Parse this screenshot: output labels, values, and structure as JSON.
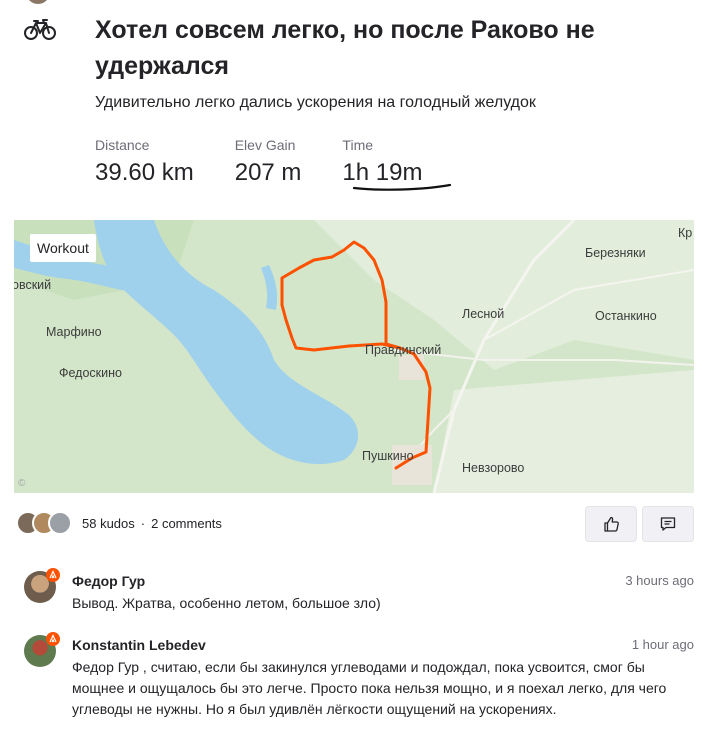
{
  "activity": {
    "icon": "bike-icon",
    "title": "Хотел совсем легко, но после Раково не удержался",
    "description": "Удивительно легко дались ускорения на голодный желудок"
  },
  "stats": [
    {
      "label": "Distance",
      "value": "39.60 km"
    },
    {
      "label": "Elev Gain",
      "value": "207 m"
    },
    {
      "label": "Time",
      "value": "1h 19m"
    }
  ],
  "map": {
    "badge": "Workout",
    "places": [
      {
        "name": "Кр"
      },
      {
        "name": "Березняки"
      },
      {
        "name": "овский"
      },
      {
        "name": "Лесной"
      },
      {
        "name": "Останкино"
      },
      {
        "name": "Марфино"
      },
      {
        "name": "Правдинский"
      },
      {
        "name": "Федоскино"
      },
      {
        "name": "Пушкино"
      },
      {
        "name": "Невзорово"
      }
    ],
    "route_color": "#fc5200"
  },
  "social": {
    "kudos": "58 kudos",
    "separator": "·",
    "comments": "2 comments",
    "kudos_button_icon": "thumbs-up-icon",
    "comment_button_icon": "comment-icon"
  },
  "comments": [
    {
      "author": "Федор Гур",
      "time": "3 hours ago",
      "text": "Вывод. Жратва, особенно летом, большое зло)"
    },
    {
      "author": "Konstantin Lebedev",
      "time": "1 hour ago",
      "text": "Федор Гур , считаю, если бы закинулся углеводами и подождал, пока усвоится, смог бы мощнее и ощущалось бы это легче. Просто пока нельзя мощно, и я поехал легко, для чего углеводы не нужны. Но я был удивлён лёгкости ощущений на ускорениях."
    }
  ],
  "colors": {
    "brand": "#fc5200",
    "text": "#242428",
    "muted": "#6d6d78"
  }
}
